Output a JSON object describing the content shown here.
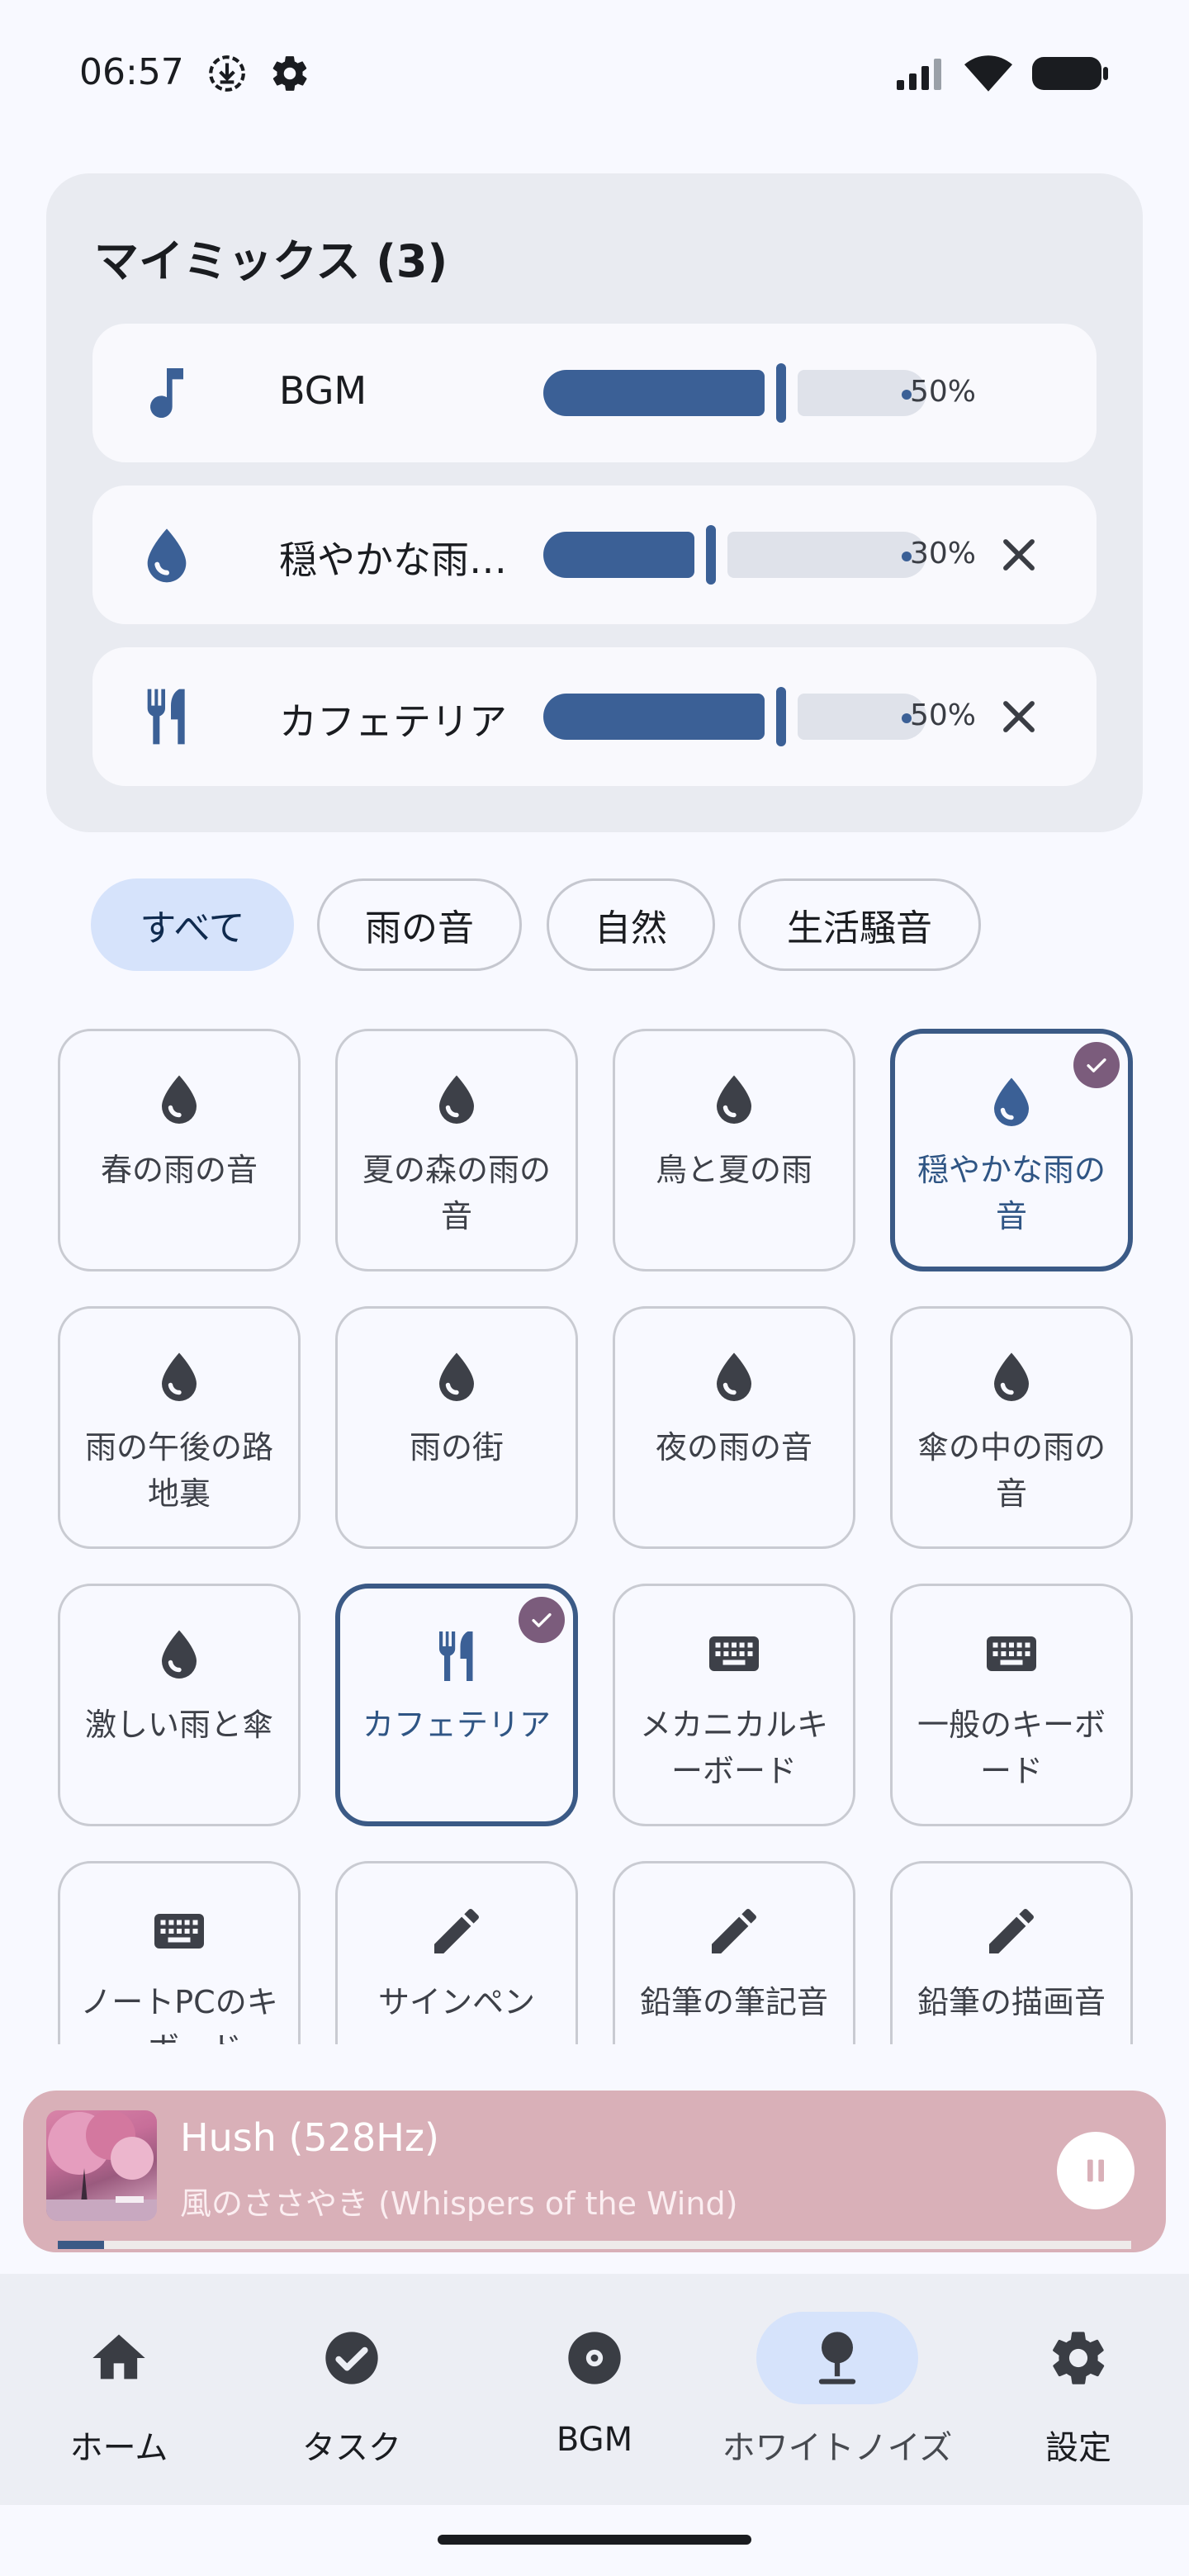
{
  "status_bar": {
    "time": "06:57"
  },
  "mix": {
    "title": "マイミックス",
    "count": "(3)",
    "items": [
      {
        "icon": "music-note-icon",
        "label": "BGM",
        "level": 0.5,
        "percent": "50%",
        "removable": false
      },
      {
        "icon": "water-drop-icon",
        "label": "穏やかな雨…",
        "level": 0.3,
        "percent": "30%",
        "removable": true
      },
      {
        "icon": "restaurant-icon",
        "label": "カフェテリア",
        "level": 0.5,
        "percent": "50%",
        "removable": true
      }
    ]
  },
  "filters": {
    "chips": [
      "すべて",
      "雨の音",
      "自然",
      "生活騒音"
    ],
    "selected": "すべて"
  },
  "sounds": [
    {
      "label": "春の雨の音",
      "icon": "water-drop-icon",
      "selected": false
    },
    {
      "label": "夏の森の雨の音",
      "icon": "water-drop-icon",
      "selected": false
    },
    {
      "label": "鳥と夏の雨",
      "icon": "water-drop-icon",
      "selected": false
    },
    {
      "label": "穏やかな雨の音",
      "icon": "water-drop-icon",
      "selected": true
    },
    {
      "label": "雨の午後の路地裏",
      "icon": "water-drop-icon",
      "selected": false
    },
    {
      "label": "雨の街",
      "icon": "water-drop-icon",
      "selected": false
    },
    {
      "label": "夜の雨の音",
      "icon": "water-drop-icon",
      "selected": false
    },
    {
      "label": "傘の中の雨の音",
      "icon": "water-drop-icon",
      "selected": false
    },
    {
      "label": "激しい雨と傘",
      "icon": "water-drop-icon",
      "selected": false
    },
    {
      "label": "カフェテリア",
      "icon": "restaurant-icon",
      "selected": true
    },
    {
      "label": "メカニカルキーボード",
      "icon": "keyboard-icon",
      "selected": false
    },
    {
      "label": "一般のキーボード",
      "icon": "keyboard-icon",
      "selected": false
    },
    {
      "label": "ノートPCのキーボード",
      "icon": "keyboard-icon",
      "selected": false
    },
    {
      "label": "サインペン",
      "icon": "pencil-icon",
      "selected": false
    },
    {
      "label": "鉛筆の筆記音",
      "icon": "pencil-icon",
      "selected": false
    },
    {
      "label": "鉛筆の描画音",
      "icon": "pencil-icon",
      "selected": false
    }
  ],
  "player": {
    "title": "Hush (528Hz)",
    "subtitle": "風のささやき (Whispers of the Wind)",
    "progress": 0.02
  },
  "nav": {
    "items": [
      "ホーム",
      "タスク",
      "BGM",
      "ホワイトノイズ",
      "設定"
    ],
    "active": "ホワイトノイズ"
  },
  "colors": {
    "accent": "#3b6096",
    "chip_active": "#d6e3fb",
    "check_badge": "#7b5c7c",
    "player_bg": "#d9b0b8"
  }
}
